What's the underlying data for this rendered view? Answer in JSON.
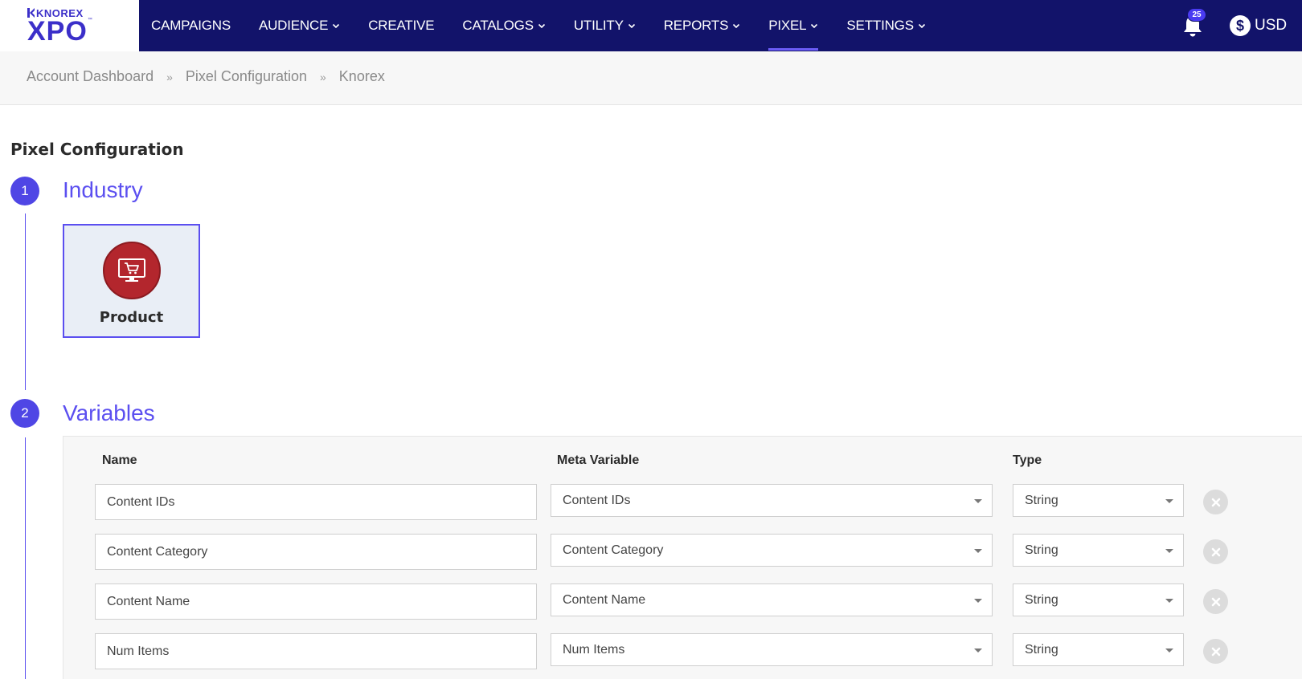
{
  "brand": {
    "small": "KNOREX",
    "big": "XPO",
    "tm": "™"
  },
  "nav": {
    "items": [
      {
        "label": "CAMPAIGNS",
        "dropdown": false,
        "active": false
      },
      {
        "label": "AUDIENCE",
        "dropdown": true,
        "active": false
      },
      {
        "label": "CREATIVE",
        "dropdown": false,
        "active": false
      },
      {
        "label": "CATALOGS",
        "dropdown": true,
        "active": false
      },
      {
        "label": "UTILITY",
        "dropdown": true,
        "active": false
      },
      {
        "label": "REPORTS",
        "dropdown": true,
        "active": false
      },
      {
        "label": "PIXEL",
        "dropdown": true,
        "active": true
      },
      {
        "label": "SETTINGS",
        "dropdown": true,
        "active": false
      }
    ],
    "notifications_count": "25",
    "currency_symbol": "$",
    "currency": "USD"
  },
  "breadcrumb": {
    "items": [
      "Account Dashboard",
      "Pixel Configuration",
      "Knorex"
    ],
    "separator": "»"
  },
  "page": {
    "title": "Pixel Configuration"
  },
  "steps": {
    "industry": {
      "number": "1",
      "title": "Industry",
      "card_label": "Product",
      "card_icon": "shopping-cart-monitor-icon"
    },
    "variables": {
      "number": "2",
      "title": "Variables"
    }
  },
  "variables": {
    "headers": {
      "name": "Name",
      "meta": "Meta Variable",
      "type": "Type"
    },
    "rows": [
      {
        "name": "Content IDs",
        "meta": "Content IDs",
        "type": "String"
      },
      {
        "name": "Content Category",
        "meta": "Content Category",
        "type": "String"
      },
      {
        "name": "Content Name",
        "meta": "Content Name",
        "type": "String"
      },
      {
        "name": "Num Items",
        "meta": "Num Items",
        "type": "String"
      }
    ]
  },
  "colors": {
    "nav_bg": "#12136a",
    "accent": "#5b4ff0",
    "industry_icon": "#b3262d"
  }
}
